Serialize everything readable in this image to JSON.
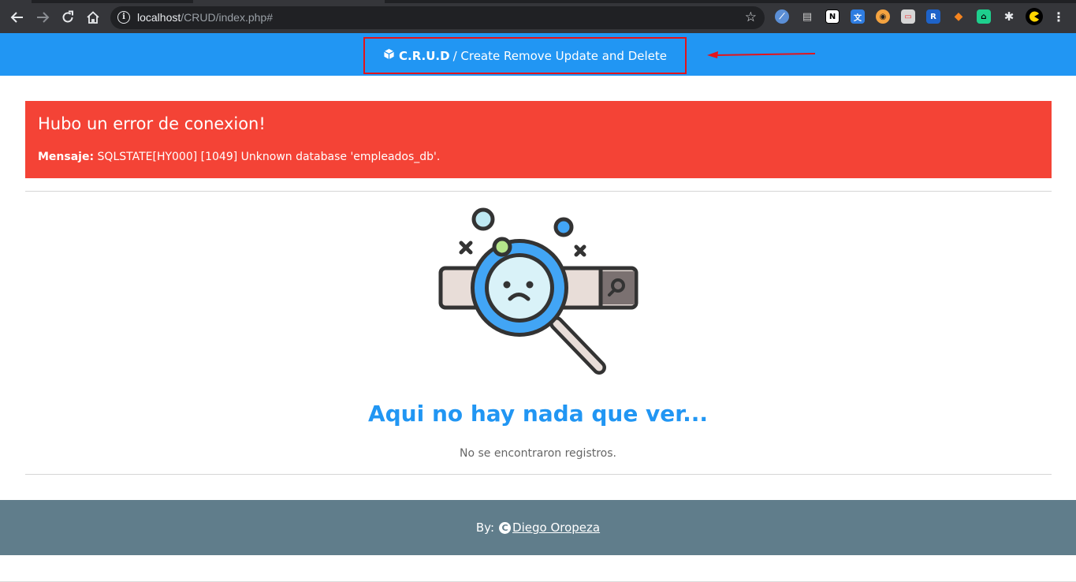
{
  "browser": {
    "url_host": "localhost",
    "url_path": "/CRUD/index.php#",
    "nav_icons": [
      "back-arrow-icon",
      "forward-arrow-icon",
      "reload-icon",
      "home-icon"
    ],
    "extensions": [
      "compass-icon",
      "printer-icon",
      "notion-icon",
      "translate-icon",
      "eyes-icon",
      "tab-icon",
      "shield-icon",
      "fox-icon",
      "robot-icon",
      "puzzle-icon",
      "pacman-avatar-icon",
      "menu-dots-icon"
    ]
  },
  "header": {
    "brand_name": "C.R.U.D",
    "tagline": "/ Create Remove Update and Delete",
    "accent_color": "#2196f3",
    "highlight_color": "#e3141b"
  },
  "alert": {
    "title": "Hubo un error de conexion!",
    "message_label": "Mensaje:",
    "message_text": "SQLSTATE[HY000] [1049] Unknown database 'empleados_db'.",
    "color": "#f44336"
  },
  "empty_state": {
    "title": "Aqui no hay nada que ver...",
    "subtitle": "No se encontraron registros."
  },
  "footer": {
    "by_label": "By:",
    "author": "Diego Oropeza",
    "color": "#607d8b"
  }
}
